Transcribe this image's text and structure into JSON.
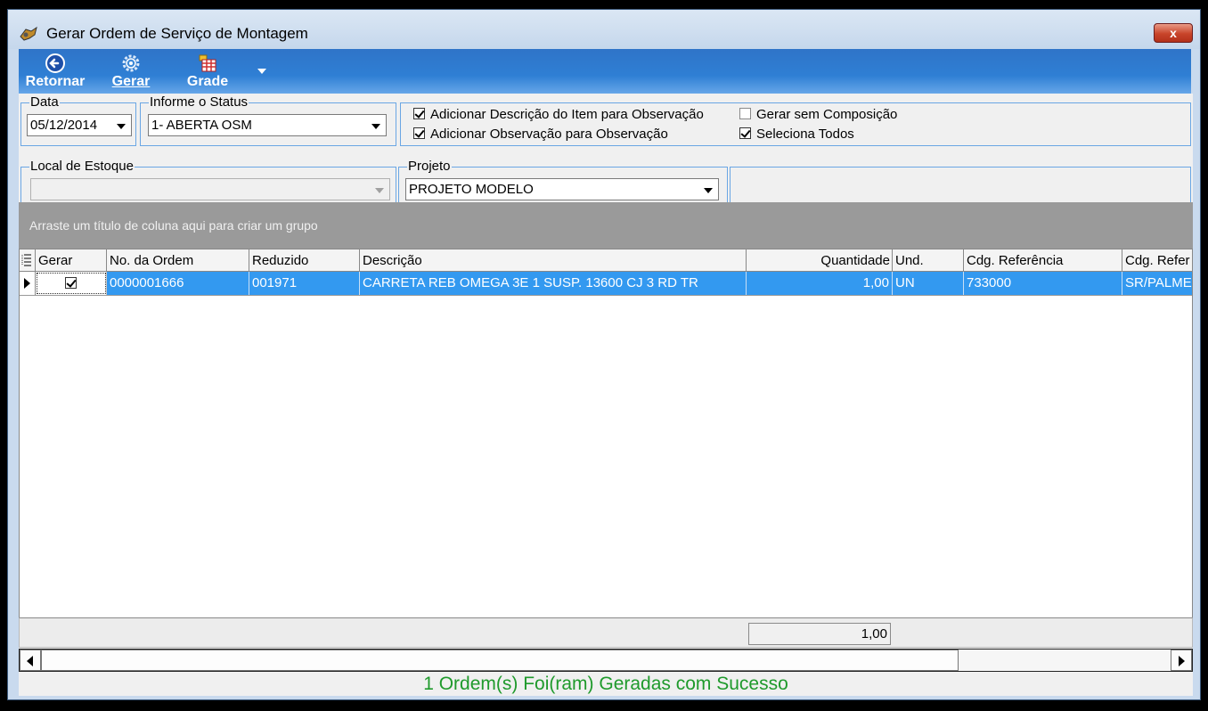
{
  "window": {
    "title": "Gerar Ordem de Serviço de Montagem",
    "close_label": "x"
  },
  "toolbar": {
    "retornar_label": "Retornar",
    "gerar_label": "Gerar",
    "grade_label": "Grade"
  },
  "data_group": {
    "title": "Data",
    "value": "05/12/2014"
  },
  "status_group": {
    "title": "Informe o Status",
    "value": "1- ABERTA OSM"
  },
  "options": {
    "add_desc_item": {
      "label": "Adicionar Descrição do Item para Observação",
      "checked": true
    },
    "add_obs": {
      "label": "Adicionar Observação para Observação",
      "checked": true
    },
    "gerar_sem_comp": {
      "label": "Gerar sem Composição",
      "checked": false
    },
    "seleciona_todos": {
      "label": "Seleciona Todos",
      "checked": true
    }
  },
  "local_group": {
    "title": "Local de Estoque",
    "value": ""
  },
  "projeto_group": {
    "title": "Projeto",
    "value": "PROJETO MODELO"
  },
  "group_bar": {
    "text": "Arraste um título de coluna aqui para criar um grupo"
  },
  "grid": {
    "columns": [
      "Gerar",
      "No. da Ordem",
      "Reduzido",
      "Descrição",
      "Quantidade",
      "Und.",
      "Cdg. Referência",
      "Cdg. Refer"
    ],
    "rows": [
      {
        "gerar": true,
        "ordem": "0000001666",
        "reduzido": "001971",
        "descricao": "CARRETA REB OMEGA 3E 1 SUSP. 13600 CJ 3 RD TR",
        "quantidade": "1,00",
        "und": "UN",
        "cdg_ref": "733000",
        "cdg_ref2": "SR/PALME"
      }
    ]
  },
  "footer": {
    "total_quantidade": "1,00"
  },
  "status_message": "1 Ordem(s) Foi(ram) Geradas com Sucesso",
  "colors": {
    "accent": "#2f7fd4",
    "selection": "#3399f0",
    "success": "#1f9a2c"
  }
}
